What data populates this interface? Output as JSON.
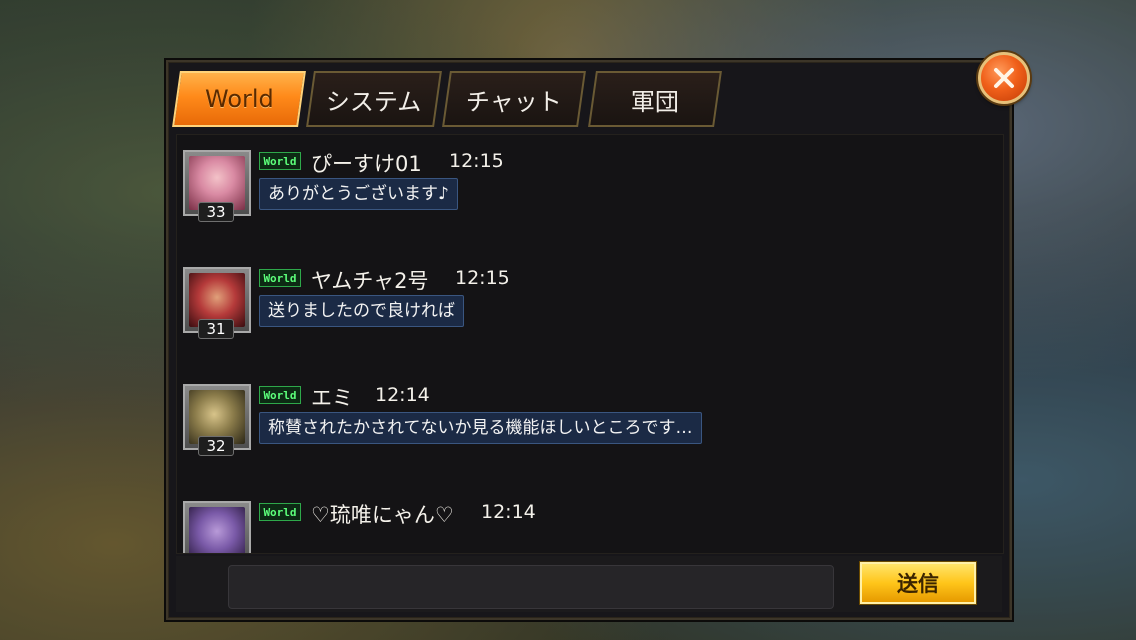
{
  "tabs": [
    {
      "label": "World",
      "active": true
    },
    {
      "label": "システム",
      "active": false
    },
    {
      "label": "チャット",
      "active": false
    },
    {
      "label": "軍団",
      "active": false
    }
  ],
  "messages": [
    {
      "channel": "World",
      "name": "ぴーすけ01",
      "time": "12:15",
      "text": "ありがとうございます♪",
      "level": "33",
      "avatar_color": "#d98aa3"
    },
    {
      "channel": "World",
      "name": "ヤムチャ2号",
      "time": "12:15",
      "text": "送りましたので良ければ",
      "level": "31",
      "avatar_color": "#b53a3a"
    },
    {
      "channel": "World",
      "name": "エミ",
      "time": "12:14",
      "text": "称賛されたかされてないか見る機能ほしいところです…",
      "level": "32",
      "avatar_color": "#8a7b4a"
    },
    {
      "channel": "World",
      "name": "♡琉唯にゃん♡",
      "time": "12:14",
      "text": "",
      "level": "",
      "avatar_color": "#7a5aa8"
    }
  ],
  "input": {
    "value": "",
    "placeholder": ""
  },
  "send_button": {
    "label": "送信"
  },
  "colors": {
    "active_tab": "#ff8a1a",
    "send_button": "#ffc51a",
    "close_button": "#f0601a",
    "world_tag": "#5cff7a",
    "bubble_bg": "#1b2a45"
  },
  "icons": {
    "close": "close-x-icon"
  }
}
